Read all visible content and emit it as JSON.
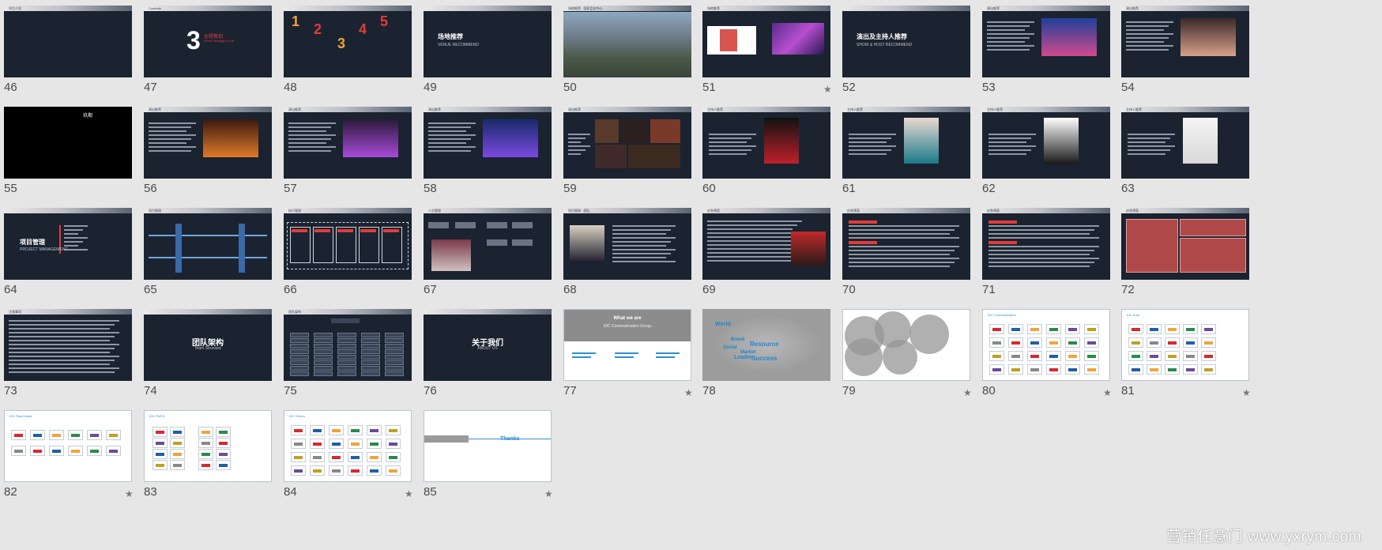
{
  "slides": [
    {
      "number": "46",
      "theme": "dark",
      "banner": "项目介绍"
    },
    {
      "number": "47",
      "theme": "dark",
      "banner": "Contents",
      "big_number": "3",
      "red_title": "全程策划",
      "subtitle": "Event Strategy & Exe"
    },
    {
      "number": "48",
      "theme": "dark",
      "numbers": [
        "1",
        "2",
        "3",
        "4",
        "5"
      ]
    },
    {
      "number": "49",
      "theme": "dark",
      "title": "场地推荐",
      "subtitle": "VENUE RECOMMEND"
    },
    {
      "number": "50",
      "theme": "dark",
      "banner": "场地推荐 · 国家会议中心"
    },
    {
      "number": "51",
      "theme": "dark",
      "banner": "场地推荐",
      "starred": true
    },
    {
      "number": "52",
      "theme": "dark",
      "title": "演出及主持人推荐",
      "subtitle": "SHOW & HOST RECOMMEND"
    },
    {
      "number": "53",
      "theme": "dark",
      "banner": "演出推荐"
    },
    {
      "number": "54",
      "theme": "dark",
      "banner": "演出推荐"
    },
    {
      "number": "55",
      "theme": "black",
      "title": "玖期"
    },
    {
      "number": "56",
      "theme": "dark",
      "banner": "演出推荐"
    },
    {
      "number": "57",
      "theme": "dark",
      "banner": "演出推荐"
    },
    {
      "number": "58",
      "theme": "dark",
      "banner": "演出推荐"
    },
    {
      "number": "59",
      "theme": "dark",
      "banner": "演出推荐"
    },
    {
      "number": "60",
      "theme": "dark",
      "banner": "主持人推荐"
    },
    {
      "number": "61",
      "theme": "dark",
      "banner": "主持人推荐"
    },
    {
      "number": "62",
      "theme": "dark",
      "banner": "主持人推荐"
    },
    {
      "number": "63",
      "theme": "dark",
      "banner": "主持人推荐"
    },
    {
      "number": "64",
      "theme": "dark",
      "title": "项目管理",
      "subtitle": "PROJECT MANAGEMENT"
    },
    {
      "number": "65",
      "theme": "dark",
      "banner": "项目管理"
    },
    {
      "number": "66",
      "theme": "dark",
      "banner": "执行管理"
    },
    {
      "number": "67",
      "theme": "dark",
      "banner": "人员管理"
    },
    {
      "number": "68",
      "theme": "dark",
      "banner": "项目管理 · 团队"
    },
    {
      "number": "69",
      "theme": "dark",
      "banner": "应急预案"
    },
    {
      "number": "70",
      "theme": "dark",
      "banner": "应急预案"
    },
    {
      "number": "71",
      "theme": "dark",
      "banner": "应急预案"
    },
    {
      "number": "72",
      "theme": "dark",
      "banner": "应急预案"
    },
    {
      "number": "73",
      "theme": "dark",
      "banner": "注意事项"
    },
    {
      "number": "74",
      "theme": "dark",
      "title": "团队架构",
      "subtitle": "Team Structure"
    },
    {
      "number": "75",
      "theme": "dark",
      "banner": "团队架构"
    },
    {
      "number": "76",
      "theme": "dark",
      "title": "关于我们",
      "subtitle": "ABOUT US"
    },
    {
      "number": "77",
      "theme": "light",
      "title": "What we are",
      "subtitle": "IDC Communication Group",
      "starred": true
    },
    {
      "number": "78",
      "theme": "gray",
      "words": [
        "World",
        "Brand",
        "Resource",
        "Social",
        "Market",
        "Leader",
        "Success"
      ]
    },
    {
      "number": "79",
      "theme": "light",
      "starred": true
    },
    {
      "number": "80",
      "theme": "light",
      "banner": "IDC Communication",
      "starred": true
    },
    {
      "number": "81",
      "theme": "light",
      "banner": "IDC Auto",
      "starred": true
    },
    {
      "number": "82",
      "theme": "light",
      "banner": "IDC Real Estate",
      "starred": true
    },
    {
      "number": "83",
      "theme": "light",
      "banner": "IDC FMCG"
    },
    {
      "number": "84",
      "theme": "light",
      "banner": "IDC Others",
      "starred": true
    },
    {
      "number": "85",
      "theme": "light",
      "title": "Thanks",
      "starred": true
    }
  ],
  "star_glyph": "★",
  "watermark": "营销任意门 www.yxrym.com",
  "colors": {
    "background": "#e6e6e6",
    "slide_dark": "#1b2330",
    "accent_red": "#e23b3b",
    "accent_blue": "#2d8fd0"
  }
}
